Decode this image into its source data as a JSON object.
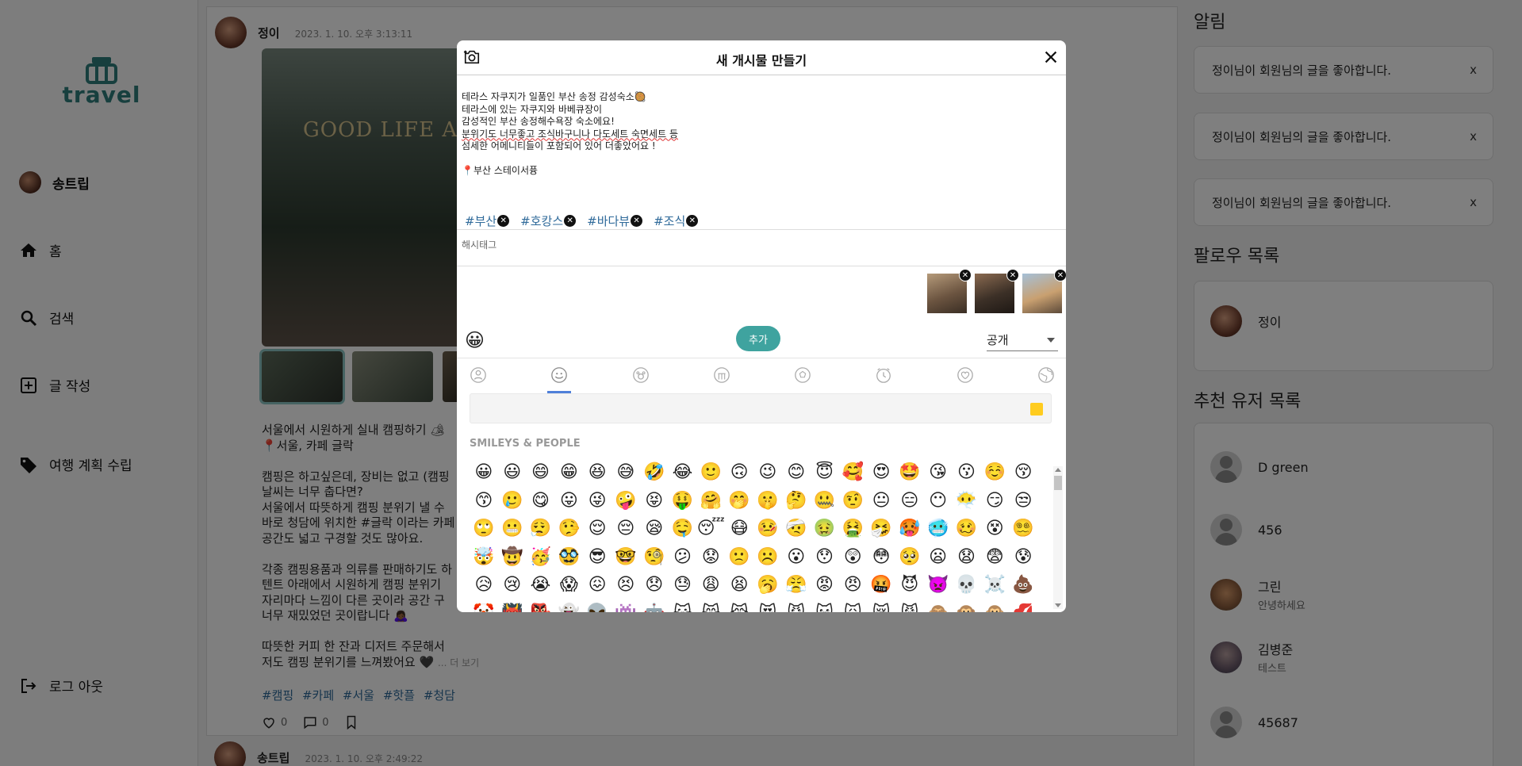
{
  "sidebar": {
    "logo_text": "travel",
    "profile_name": "송트립",
    "items": [
      {
        "label": "홈",
        "icon": "home-icon"
      },
      {
        "label": "검색",
        "icon": "search-icon"
      },
      {
        "label": "글 작성",
        "icon": "plus-square-icon"
      },
      {
        "label": "여행 계획 수립",
        "icon": "tag-icon"
      }
    ],
    "logout_label": "로그 아웃"
  },
  "feed": {
    "post": {
      "author": "정이",
      "time": "2023. 1. 10. 오후 3:13:11",
      "photo_sign": "GOOD LIFE AL",
      "body": "서울에서 시원하게 실내 캠핑하기 🏕\n📍서울, 카페 글락\n\n캠핑은 하고싶은데, 장비는 없고 (캠핑\n날씨는 너무 춥다면?\n서울에서 따뜻하게 캠핑 분위기 낼 수\n바로 청담에 위치한 #글락 이라는 카페\n공간도 넓고 구경할 것도 많아요.\n\n각종 캠핑용품과 의류를 판매하기도 하\n텐트 아래에서 시원하게 캠핑 분위기\n자리마다 느낌이 다른 곳이라 공간 구\n너무 재밌었던 곳이랍니다 🙇🏾‍♀️\n\n따뜻한 커피 한 잔과 디저트 주문해서\n저도 캠핑 분위기를 느껴봤어요 🖤",
      "more": "... 더 보기",
      "tags": [
        "#캠핑",
        "#카페",
        "#서울",
        "#핫플",
        "#청담"
      ],
      "likes": "0",
      "comments": "0"
    },
    "post2": {
      "author": "송트립",
      "time": "2023. 1. 10. 오후 2:49:22"
    }
  },
  "right": {
    "notifications_title": "알림",
    "notifications": [
      {
        "text": "정이님이 회원님의 글을 좋아합니다.",
        "close": "x"
      },
      {
        "text": "정이님이 회원님의 글을 좋아합니다.",
        "close": "x"
      },
      {
        "text": "정이님이 회원님의 글을 좋아합니다.",
        "close": "x"
      }
    ],
    "follow_title": "팔로우 목록",
    "follows": [
      {
        "name": "정이"
      }
    ],
    "recommend_title": "추천 유저 목록",
    "recommends": [
      {
        "name": "D green",
        "sub": ""
      },
      {
        "name": "456",
        "sub": ""
      },
      {
        "name": "그린",
        "sub": "안녕하세요"
      },
      {
        "name": "김병준",
        "sub": "테스트"
      },
      {
        "name": "45687",
        "sub": ""
      }
    ]
  },
  "modal": {
    "title": "새 개시물 만들기",
    "text_lines": [
      "테라스 자쿠지가 일품인 부산 송정 감성숙소🥘",
      "테라스에 있는 자쿠지와 바베큐장이",
      "감성적인 부산 송정해수욕장 숙소에요!",
      "분위기도 너무좋고 조식바구니나 다도세트 숙면세트 등",
      "섬세한 어메니티들이 포함되어 있어 더좋았어요 !",
      "",
      "📍부산 스테이서퓽"
    ],
    "hashtags": [
      "#부산",
      "#호캉스",
      "#바다뷰",
      "#조식"
    ],
    "hashtag_placeholder": "해시태그",
    "emoji_button": "😀",
    "add_label": "추가",
    "visibility": "공개",
    "picker": {
      "categories": [
        "person-icon",
        "smiley-icon",
        "animal-icon",
        "food-icon",
        "ball-icon",
        "clock-icon",
        "heart-icon",
        "globe-icon"
      ],
      "tone_color": "#ffcc1f",
      "section": "SMILEYS & PEOPLE",
      "emojis": "😀😃😄😁😆😅🤣😂🙂🙃😉😊😇🥰😍🤩😘😗☺️😚😙🥲😋😛😜🤪😝🤑🤗🤭🤫🤔🤐🤨😐😑😶😶‍🌫️😏😒🙄😬😮‍💨🤥😌😔😪🤤😴😷🤒🤕🤢🤮🤧🥵🥶🥴😵😵‍💫🤯🤠🥳🥸😎🤓🧐😕😟🙁☹️😮😯😲😳🥺😦😧😨😰😥😢😭😱😖😣😞😓😩😫🥱😤😡😠🤬😈👿💀☠️💩🤡👹👺👻👽👾🤖😺😸😹😻😼😽🙀😿😾🙈🙉🙊💋"
    }
  }
}
